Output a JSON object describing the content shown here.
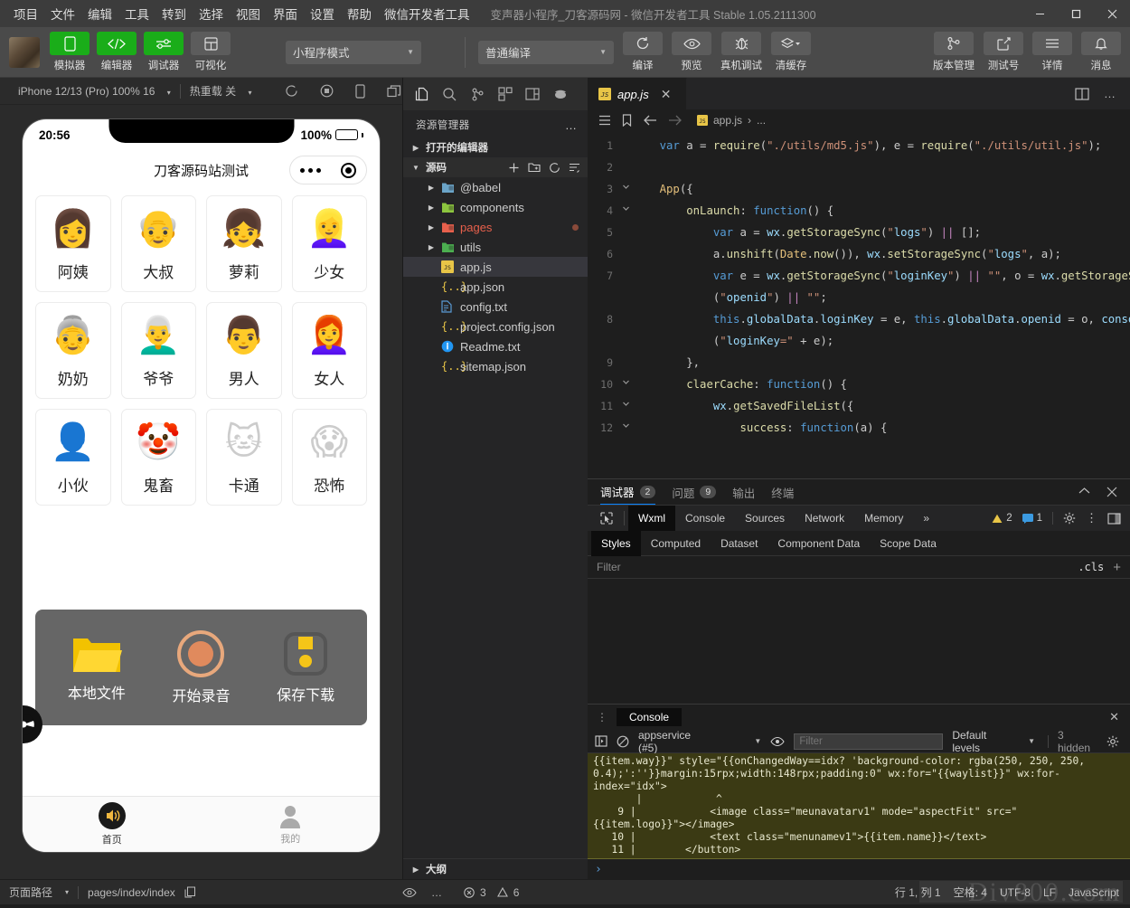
{
  "titlebar": {
    "menu": [
      "项目",
      "文件",
      "编辑",
      "工具",
      "转到",
      "选择",
      "视图",
      "界面",
      "设置",
      "帮助",
      "微信开发者工具"
    ],
    "window_title": "变声器小程序_刀客源码网 - 微信开发者工具 Stable 1.05.2111300",
    "minimize": "—",
    "maximize": "▢",
    "close": "✕"
  },
  "toolbar": {
    "buttons": [
      {
        "label": "模拟器",
        "icon": "phone-icon",
        "active": true
      },
      {
        "label": "编辑器",
        "icon": "code-icon",
        "active": true
      },
      {
        "label": "调试器",
        "icon": "sliders-icon",
        "active": true
      },
      {
        "label": "可视化",
        "icon": "layout-icon",
        "active": false
      }
    ],
    "mode_select": "小程序模式",
    "compile_select": "普通编译",
    "actions": [
      {
        "label": "编译",
        "icon": "refresh-icon"
      },
      {
        "label": "预览",
        "icon": "eye-icon"
      },
      {
        "label": "真机调试",
        "icon": "bug-icon"
      },
      {
        "label": "清缓存",
        "icon": "layers-icon"
      }
    ],
    "right_actions": [
      {
        "label": "版本管理",
        "icon": "branch-icon"
      },
      {
        "label": "测试号",
        "icon": "external-link-icon"
      },
      {
        "label": "详情",
        "icon": "menu-icon"
      },
      {
        "label": "消息",
        "icon": "bell-icon"
      }
    ]
  },
  "simulator": {
    "device_select": "iPhone 12/13 (Pro) 100% 16",
    "hotreload_select": "热重载 关",
    "phone": {
      "status_time": "20:56",
      "battery_percent": "100%",
      "nav_title": "刀客源码站测试",
      "grid": [
        {
          "name": "阿姨",
          "emoji": "👩"
        },
        {
          "name": "大叔",
          "emoji": "👴"
        },
        {
          "name": "萝莉",
          "emoji": "👧"
        },
        {
          "name": "少女",
          "emoji": "👱‍♀️"
        },
        {
          "name": "奶奶",
          "emoji": "👵"
        },
        {
          "name": "爷爷",
          "emoji": "👨‍🦳"
        },
        {
          "name": "男人",
          "emoji": "👨"
        },
        {
          "name": "女人",
          "emoji": "👩‍🦰"
        },
        {
          "name": "小伙",
          "emoji": "👤"
        },
        {
          "name": "鬼畜",
          "emoji": "🤡"
        },
        {
          "name": "卡通",
          "emoji": "🐱"
        },
        {
          "name": "恐怖",
          "emoji": "😱"
        }
      ],
      "actions": [
        {
          "label": "本地文件",
          "icon": "folder-icon"
        },
        {
          "label": "开始录音",
          "icon": "record-icon"
        },
        {
          "label": "保存下载",
          "icon": "save-icon"
        }
      ],
      "tabbar": [
        {
          "label": "首页",
          "icon": "speaker-icon",
          "active": true
        },
        {
          "label": "我的",
          "icon": "person-icon",
          "active": false
        }
      ]
    }
  },
  "explorer": {
    "activity_icons": [
      "files-icon",
      "search-icon",
      "source-control-icon",
      "extensions-icon",
      "split-icon",
      "debug-icon"
    ],
    "title": "资源管理器",
    "more": "…",
    "open_editors": "打开的编辑器",
    "source_section": "源码",
    "section_actions": [
      "new-file-icon",
      "new-folder-icon",
      "refresh-icon",
      "collapse-icon"
    ],
    "tree": [
      {
        "label": "@babel",
        "type": "folder",
        "color": "#6ba4c8",
        "modified": false
      },
      {
        "label": "components",
        "type": "folder",
        "color": "#8dc63f",
        "modified": false
      },
      {
        "label": "pages",
        "type": "folder",
        "color": "#e8604c",
        "modified": true
      },
      {
        "label": "utils",
        "type": "folder",
        "color": "#4caf50",
        "modified": false
      },
      {
        "label": "app.js",
        "type": "js",
        "color": "#e8c547",
        "selected": true
      },
      {
        "label": "app.json",
        "type": "json",
        "color": "#e8c547"
      },
      {
        "label": "config.txt",
        "type": "txt",
        "color": "#5a9bd5"
      },
      {
        "label": "project.config.json",
        "type": "json",
        "color": "#e8c547"
      },
      {
        "label": "Readme.txt",
        "type": "info",
        "color": "#2196f3"
      },
      {
        "label": "sitemap.json",
        "type": "json",
        "color": "#e8c547"
      }
    ],
    "outline": "大纲"
  },
  "editor": {
    "tab": {
      "label": "app.js",
      "icon": "js-icon",
      "close": "✕"
    },
    "tab_actions": [
      "split-editor-icon",
      "more-actions-icon"
    ],
    "breadcrumb_icons": [
      "outline-list-icon",
      "bookmark-icon",
      "back-arrow-icon",
      "forward-arrow-icon"
    ],
    "breadcrumb": "app.js",
    "breadcrumb_sep": "›",
    "breadcrumb_tail": "...",
    "lines": [
      {
        "n": "1",
        "fold": "",
        "code": "    var a = require(\"./utils/md5.js\"), e = require(\"./utils/util.js\");"
      },
      {
        "n": "2",
        "fold": "",
        "code": ""
      },
      {
        "n": "3",
        "fold": "v",
        "code": "    App({"
      },
      {
        "n": "4",
        "fold": "v",
        "code": "        onLaunch: function() {"
      },
      {
        "n": "5",
        "fold": "",
        "code": "            var a = wx.getStorageSync(\"logs\") || [];"
      },
      {
        "n": "6",
        "fold": "",
        "code": "            a.unshift(Date.now()), wx.setStorageSync(\"logs\", a);"
      },
      {
        "n": "7",
        "fold": "",
        "code": "            var e = wx.getStorageSync(\"loginKey\") || \"\", o = wx.getStorageSync"
      },
      {
        "n": "",
        "fold": "",
        "code": "            (\"openid\") || \"\";"
      },
      {
        "n": "8",
        "fold": "",
        "code": "            this.globalData.loginKey = e, this.globalData.openid = o, console.log"
      },
      {
        "n": "",
        "fold": "",
        "code": "            (\"loginKey=\" + e);"
      },
      {
        "n": "9",
        "fold": "",
        "code": "        },"
      },
      {
        "n": "10",
        "fold": "v",
        "code": "        claerCache: function() {"
      },
      {
        "n": "11",
        "fold": "v",
        "code": "            wx.getSavedFileList({"
      },
      {
        "n": "12",
        "fold": "v",
        "code": "                success: function(a) {"
      }
    ]
  },
  "debugger": {
    "tabs": [
      {
        "label": "调试器",
        "badge": "2",
        "active": true
      },
      {
        "label": "问题",
        "badge": "9",
        "active": false
      },
      {
        "label": "输出",
        "badge": "",
        "active": false
      },
      {
        "label": "终端",
        "badge": "",
        "active": false
      }
    ],
    "collapse_icon": "chevron-up-icon",
    "close_icon": "close-icon",
    "devtools_tabs": [
      "Wxml",
      "Console",
      "Sources",
      "Network",
      "Memory"
    ],
    "devtools_active": "Wxml",
    "devtools_more": "»",
    "warning_count": "2",
    "message_count": "1",
    "devtools_right_icons": [
      "settings-gear-icon",
      "more-vertical-icon",
      "dock-icon"
    ],
    "style_tabs": [
      "Styles",
      "Computed",
      "Dataset",
      "Component Data",
      "Scope Data"
    ],
    "style_active": "Styles",
    "filter_placeholder": "Filter",
    "cls_label": ".cls",
    "plus_label": "+"
  },
  "console": {
    "tab": "Console",
    "close": "✕",
    "context": "appservice (#5)",
    "filter_placeholder": "Filter",
    "levels": "Default levels",
    "hidden": "3 hidden",
    "settings_icon": "settings-gear-icon",
    "output": "{{item.way}}\" style=\"{{onChangedWay==idx? 'background-color: rgba(250, 250, 250,\n0.4);':''}}margin:15rpx;width:148rpx;padding:0\" wx:for=\"{{waylist}}\" wx:for-\nindex=\"idx\">\n       |            ^\n    9 |            <image class=\"meunavatarv1\" mode=\"aspectFit\" src=\"\n{{item.logo}}\"></image>\n   10 |            <text class=\"menunamev1\">{{item.name}}</text>\n   11 |        </button>",
    "prompt": "›"
  },
  "statusbar": {
    "page_path_label": "页面路径",
    "page_path": "pages/index/index",
    "copy_icon": "copy-icon",
    "eye_icon": "eye-icon",
    "more_icon": "more-icon",
    "error_count": "3",
    "warning_count": "6",
    "cursor": "行 1, 列 1",
    "spaces": "空格: 4",
    "encoding": "UTF-8",
    "eol": "LF",
    "language": "JavaScript",
    "watermark": "Div800.com"
  }
}
